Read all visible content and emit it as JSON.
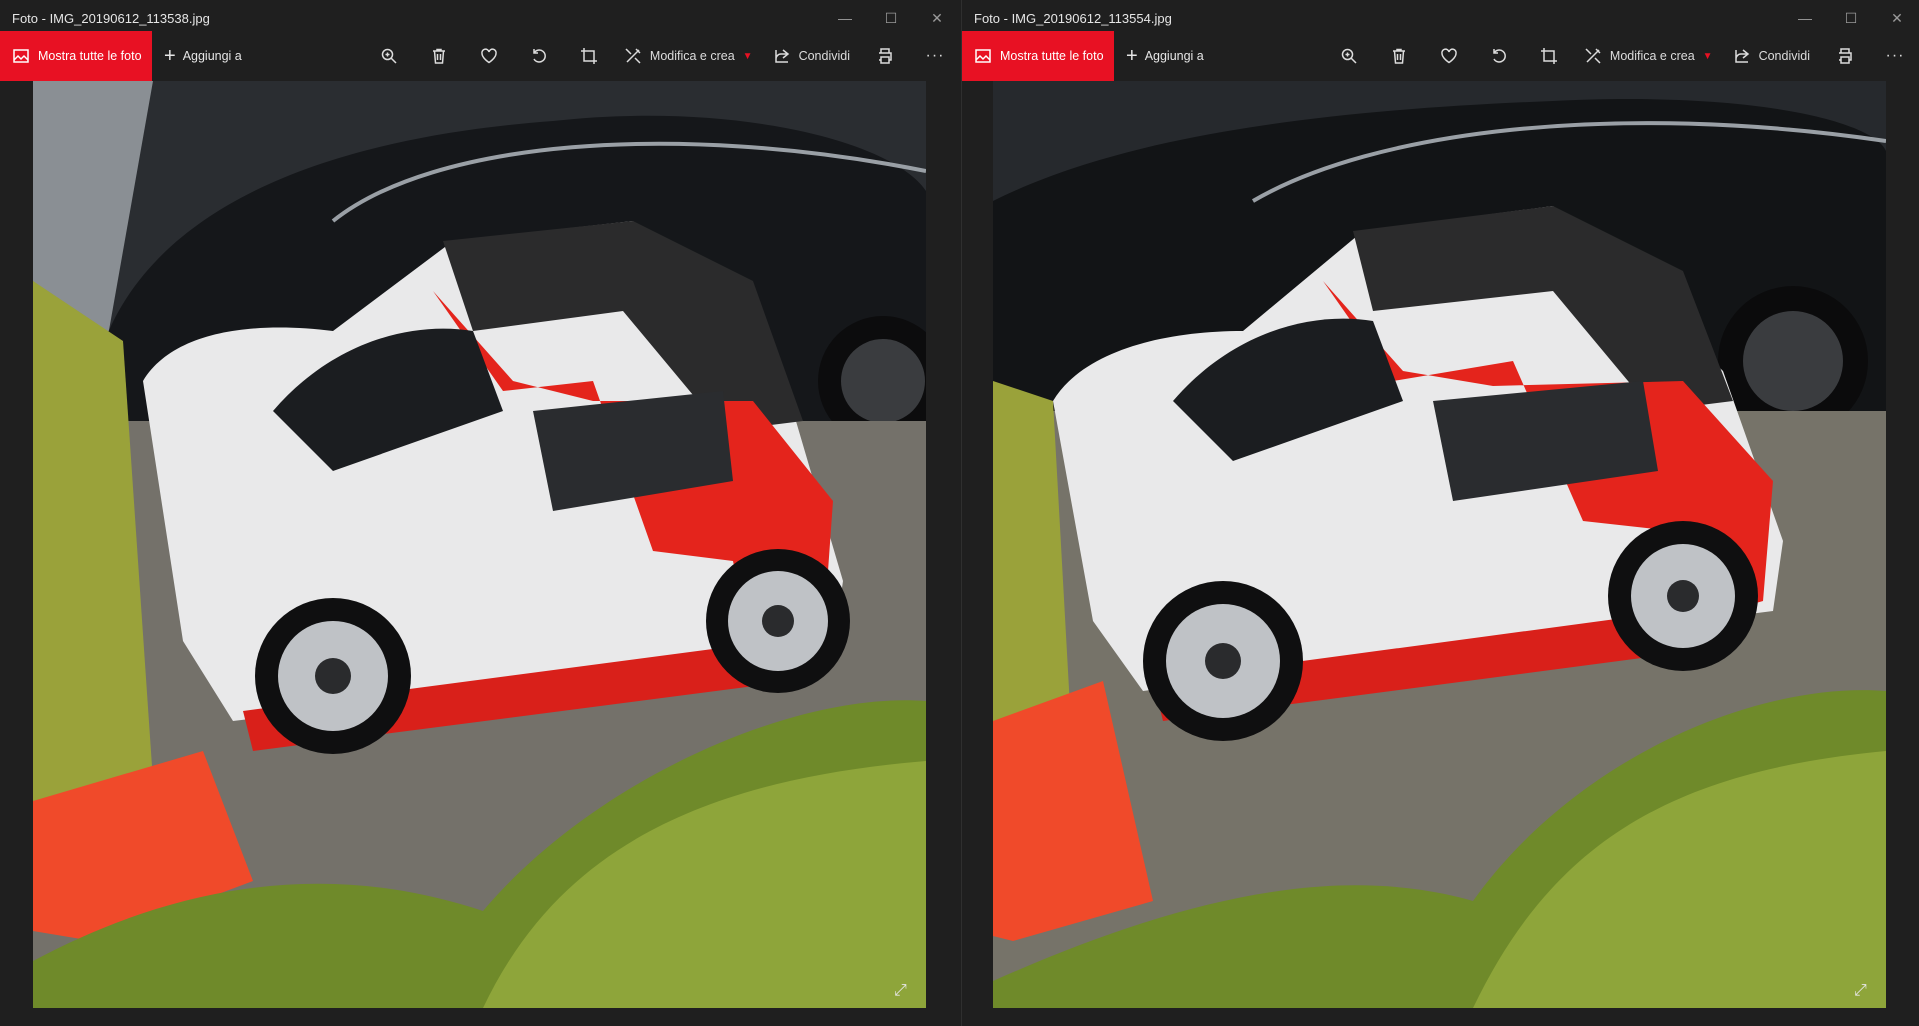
{
  "windows": [
    {
      "title": "Foto - IMG_20190612_113538.jpg",
      "show_all_label": "Mostra tutte le foto",
      "add_to_label": "Aggiungi a",
      "edit_label": "Modifica e crea",
      "share_label": "Condividi"
    },
    {
      "title": "Foto - IMG_20190612_113554.jpg",
      "show_all_label": "Mostra tutte le foto",
      "add_to_label": "Aggiungi a",
      "edit_label": "Modifica e crea",
      "share_label": "Condividi"
    }
  ],
  "colors": {
    "accent": "#e81123",
    "background": "#1f1f1f",
    "car_red": "#e4241c",
    "car_white": "#e9e9ea"
  },
  "icons": [
    "image-icon",
    "plus-icon",
    "zoom-icon",
    "trash-icon",
    "heart-icon",
    "rotate-icon",
    "crop-icon",
    "edit-icon",
    "share-icon",
    "print-icon",
    "more-icon",
    "minimize-icon",
    "maximize-icon",
    "close-icon",
    "expand-icon"
  ]
}
